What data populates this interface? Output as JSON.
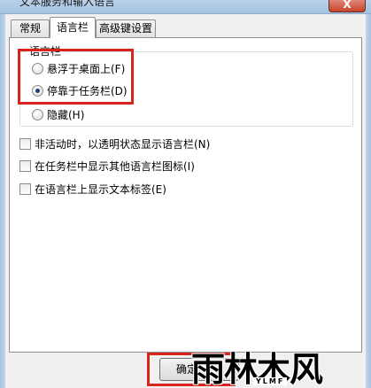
{
  "window": {
    "title": "文本服务和输入语言",
    "close_glyph": "X"
  },
  "tabs": [
    {
      "label": "常规",
      "active": false
    },
    {
      "label": "语言栏",
      "active": true
    },
    {
      "label": "高级键设置",
      "active": false
    }
  ],
  "language_bar_group": {
    "label": "语言栏",
    "options": [
      {
        "label": "悬浮于桌面上(F)",
        "checked": false
      },
      {
        "label": "停靠于任务栏(D)",
        "checked": true
      },
      {
        "label": "隐藏(H)",
        "checked": false
      }
    ]
  },
  "checkboxes": [
    {
      "label": "非活动时，以透明状态显示语言栏(N)",
      "checked": false
    },
    {
      "label": "在任务栏中显示其他语言栏图标(I)",
      "checked": false
    },
    {
      "label": "在语言栏上显示文本标签(E)",
      "checked": false
    }
  ],
  "buttons": {
    "ok_label": "确定"
  },
  "watermark": {
    "text": "雨林木风",
    "subtext": "YLMF"
  },
  "colors": {
    "highlight_red": "#d9231e",
    "panel_bg": "#ffffff",
    "dialog_bg": "#f0f0f0"
  }
}
